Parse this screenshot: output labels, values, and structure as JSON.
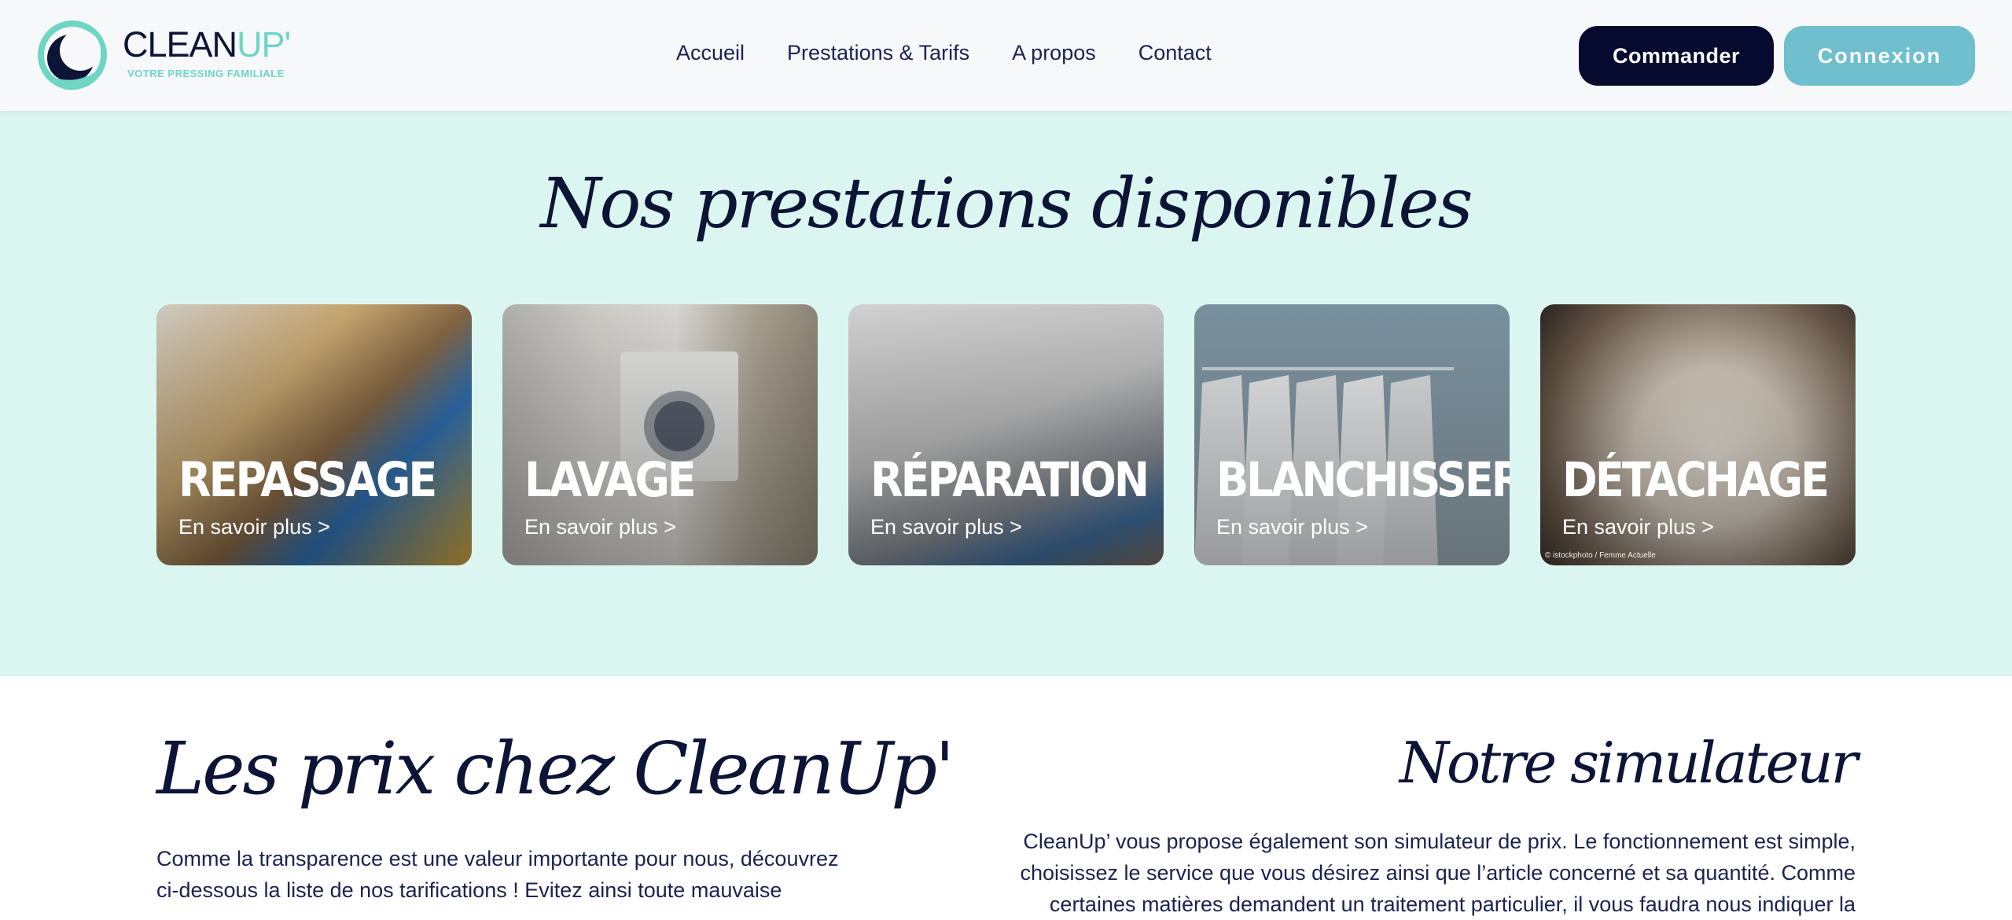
{
  "brand": {
    "name_part1": "CLEAN",
    "name_part2": "UP'",
    "tagline": "VOTRE PRESSING FAMILIALE",
    "primary_color": "#0c1536",
    "accent_color": "#6fd6c4"
  },
  "nav": {
    "items": [
      {
        "label": "Accueil"
      },
      {
        "label": "Prestations & Tarifs"
      },
      {
        "label": "A propos"
      },
      {
        "label": "Contact"
      }
    ]
  },
  "header_buttons": {
    "order_label": "Commander",
    "login_label": "Connexion"
  },
  "services": {
    "title": "Nos prestations disponibles",
    "background": "#dbf6f1",
    "cards": [
      {
        "title": "REPASSAGE",
        "link": "En savoir plus >",
        "icon": "ironing-image"
      },
      {
        "title": "LAVAGE",
        "link": "En savoir plus >",
        "icon": "washing-machine-image"
      },
      {
        "title": "RÉPARATION",
        "link": "En savoir plus >",
        "icon": "sewing-machine-image"
      },
      {
        "title": "BLANCHISSERIE",
        "link": "En savoir plus >",
        "icon": "shirts-rack-image"
      },
      {
        "title": "DÉTACHAGE",
        "link": "En savoir plus >",
        "icon": "stain-shirt-image",
        "credit": "© istockphoto / Femme Actuelle"
      }
    ]
  },
  "prices": {
    "title": "Les prix chez CleanUp'",
    "text": "Comme la transparence est une valeur importante pour nous, découvrez ci-dessous la liste de nos tarifications ! Evitez ainsi toute mauvaise"
  },
  "simulator": {
    "title": "Notre simulateur",
    "text": "CleanUp’ vous propose également son simulateur de prix. Le fonctionnement est simple, choisissez le service que vous désirez ainsi que l’article concerné et sa quantité. Comme certaines matières demandent un traitement particulier, il vous faudra nous indiquer la"
  }
}
